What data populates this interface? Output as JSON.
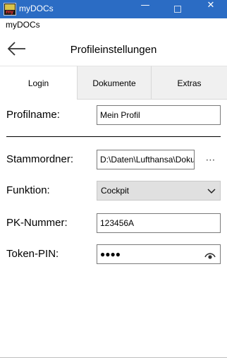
{
  "window": {
    "title": "myDOCs",
    "icon_text": "my",
    "minimize_glyph": "—",
    "close_glyph": "✕"
  },
  "caption": "myDOCs",
  "header": {
    "back_icon": "arrow-left-icon",
    "title": "Profileinstellungen"
  },
  "tabs": [
    {
      "label": "Login",
      "selected": true
    },
    {
      "label": "Dokumente",
      "selected": false
    },
    {
      "label": "Extras",
      "selected": false
    }
  ],
  "form": {
    "profile_name": {
      "label": "Profilname:",
      "value": "Mein Profil"
    },
    "root_folder": {
      "label": "Stammordner:",
      "value": "D:\\Daten\\Lufthansa\\Dokumente",
      "browse_label": "⋯"
    },
    "function": {
      "label": "Funktion:",
      "value": "Cockpit"
    },
    "pk_number": {
      "label": "PK-Nummer:",
      "value": "123456A"
    },
    "token_pin": {
      "label": "Token-PIN:",
      "value": "●●●●",
      "reveal_icon": "eye-icon"
    }
  },
  "colors": {
    "titlebar": "#2b6cc4",
    "tab_inactive": "#f0f0f0",
    "select_bg": "#e0e0e0"
  }
}
